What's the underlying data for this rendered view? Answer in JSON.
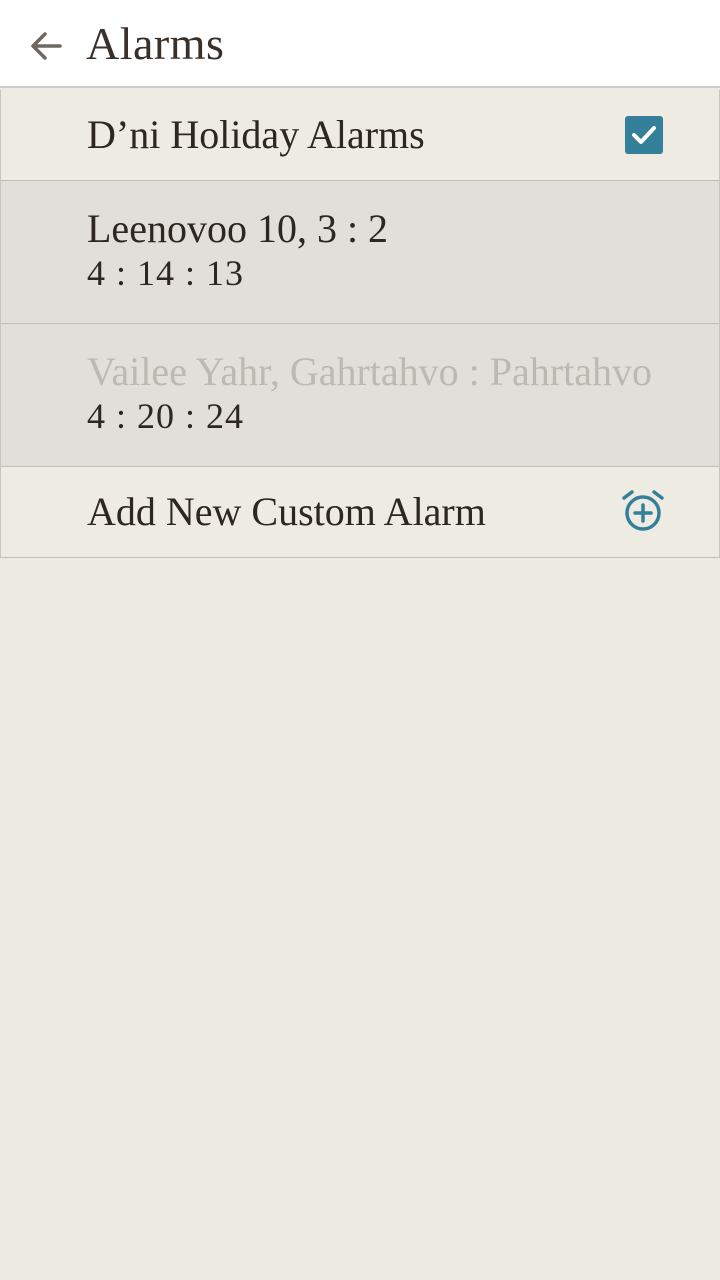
{
  "appbar": {
    "title": "Alarms",
    "back_icon": "arrow-left-icon"
  },
  "holiday_toggle": {
    "label": "D’ni Holiday Alarms",
    "checked": true,
    "check_color": "#347f9a"
  },
  "alarms": [
    {
      "line1": "Leenovoo 10,  3 : 2",
      "line2": "4 : 14 : 13",
      "line1_enabled": true
    },
    {
      "line1": "Vailee Yahr,  Gahrtahvo : Pahrtahvo",
      "line2": "4 : 20 : 24",
      "line1_enabled": false
    }
  ],
  "add_alarm": {
    "label": "Add New Custom Alarm",
    "icon": "alarm-add-icon",
    "icon_color": "#347f9a"
  }
}
